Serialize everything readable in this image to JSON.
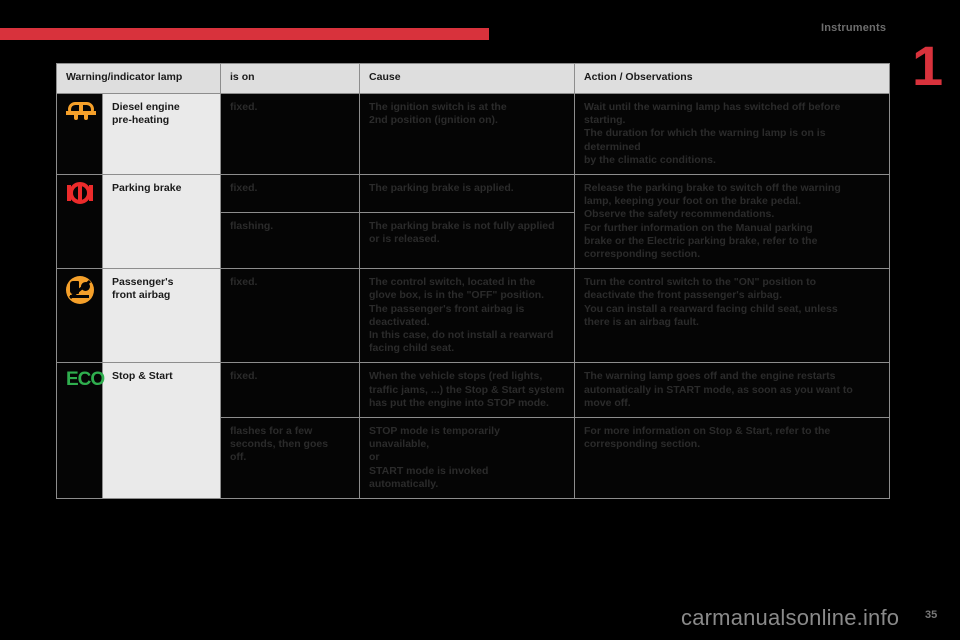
{
  "header": {
    "section_title": "Instruments",
    "chapter_number": "1",
    "rule_color": "#d8323c"
  },
  "table": {
    "columns": [
      "Warning/indicator lamp",
      "is on",
      "Cause",
      "Action / Observations"
    ],
    "rows": [
      {
        "icon": "glow-plug-icon",
        "lamp": "Diesel engine\npre-heating",
        "lamp_color": "#f5a02a",
        "subrows": [
          {
            "is_on": "fixed.",
            "cause": "The ignition switch is at the\n2nd position (ignition on).",
            "action": "Wait until the warning lamp has switched off before starting.\nThe duration for which the warning lamp is on is determined\nby the climatic conditions."
          }
        ]
      },
      {
        "icon": "parking-brake-icon",
        "lamp": "Parking brake",
        "lamp_color": "#ec2b2b",
        "subrows": [
          {
            "is_on": "fixed.",
            "cause": "The parking brake is applied.",
            "action": "Release the parking brake to switch off the warning\nlamp, keeping your foot on the brake pedal.\nObserve the safety recommendations.\nFor further information on the Manual parking\nbrake or the Electric parking brake, refer to the\ncorresponding section."
          },
          {
            "is_on": "flashing.",
            "cause": "The parking brake is not fully applied\nor is released.",
            "action": ""
          }
        ]
      },
      {
        "icon": "passenger-airbag-off-icon",
        "lamp": "Passenger's\nfront airbag",
        "lamp_color": "#f5a02a",
        "subrows": [
          {
            "is_on": "fixed.",
            "cause": "The control switch, located in the\nglove box, is in the \"OFF\" position.\nThe passenger's front airbag is\ndeactivated.\nIn this case, do not install a rearward\nfacing child seat.",
            "action": "Turn the control switch to the \"ON\" position to\ndeactivate the front passenger's airbag.\nYou can install a rearward facing child seat, unless\nthere is an airbag fault."
          }
        ]
      },
      {
        "icon": "eco-stop-start-icon",
        "lamp": "Stop & Start",
        "lamp_color": "#2fae4e",
        "subrows": [
          {
            "is_on": "fixed.",
            "cause": "When the vehicle stops (red lights,\ntraffic jams, ...) the Stop & Start system\nhas put the engine into STOP mode.",
            "action": "The warning lamp goes off and the engine restarts\nautomatically in START mode, as soon as you want to\nmove off."
          },
          {
            "is_on": "flashes for a few\nseconds, then goes\noff.",
            "cause": "STOP mode is temporarily\nunavailable,\nor\nSTART mode is invoked\nautomatically.",
            "action": "For more information on Stop & Start, refer to the\ncorresponding section."
          }
        ]
      }
    ]
  },
  "footer": {
    "watermark": "carmanualsonline.info",
    "page_number": "35"
  }
}
